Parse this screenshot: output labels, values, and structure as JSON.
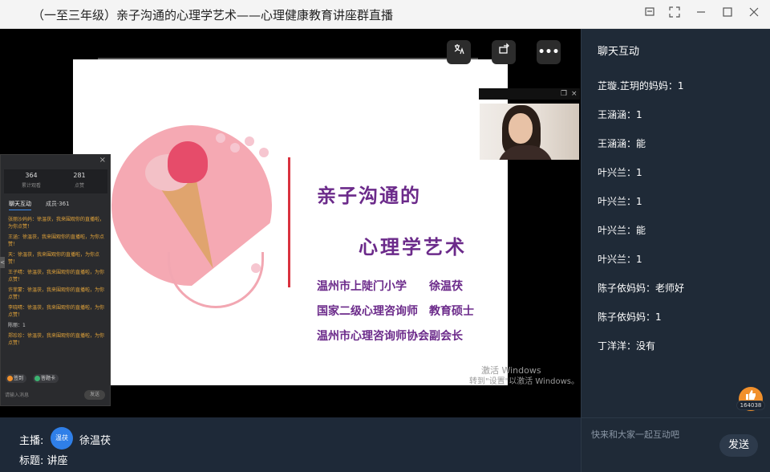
{
  "window": {
    "title": "（一至三年级）亲子沟通的心理学艺术——心理健康教育讲座群直播",
    "icons": [
      "pin-icon",
      "fullscreen-icon",
      "minimize-icon",
      "maximize-icon",
      "close-icon"
    ]
  },
  "stage": {
    "controls": [
      "translate-icon",
      "rotate-icon",
      "more-icon"
    ],
    "more_label": "•••"
  },
  "slide": {
    "title_line1": "亲子沟通的",
    "title_line2": "心理学艺术",
    "info_lines": [
      "温州市上陡门小学　　徐温茯",
      "国家二级心理咨询师　教育硕士",
      "温州市心理咨询师协会副会长"
    ],
    "watermark_line1": "激活 Windows",
    "watermark_line2": "转到\"设置\"以激活 Windows。"
  },
  "mini_panel": {
    "stat1_value": "364",
    "stat1_label": "累计观看",
    "stat2_value": "281",
    "stat2_label": "点赞",
    "tab1": "聊天互动",
    "tab2": "成员·361",
    "messages": [
      {
        "text": "张丽沙妈妈：徐温茯，我来围观你的直播啦，为你点赞！",
        "type": "msg"
      },
      {
        "text": "王涵：徐温茯，我来围观你的直播啦，为你点赞！",
        "type": "msg"
      },
      {
        "text": "天：徐温茯，我来围观你的直播啦，为你点赞！",
        "type": "msg"
      },
      {
        "text": "王子晴：徐温茯，我来围观你的直播啦，为你点赞！",
        "type": "msg"
      },
      {
        "text": "许菲蒙：徐温茯，我来围观你的直播啦，为你点赞！",
        "type": "msg"
      },
      {
        "text": "李晓晴：徐温茯，我来围观你的直播啦，为你点赞！",
        "type": "msg"
      },
      {
        "text": "陈丽：1",
        "type": "sys"
      },
      {
        "text": "郑珍珍：徐温茯，我来围观你的直播啦，为你点赞！",
        "type": "msg"
      }
    ],
    "badge1": "签到",
    "badge2": "答题卡",
    "input_placeholder": "请输入消息",
    "send_label": "发送",
    "close_label": "×",
    "handle_label": "<"
  },
  "chat": {
    "header": "聊天互动",
    "messages": [
      "芷璇.芷玥的妈妈：1",
      "王涵涵：1",
      "王涵涵：能",
      "叶兴兰：1",
      "叶兴兰：1",
      "叶兴兰：能",
      "叶兴兰：1",
      "陈子依妈妈：老师好",
      "陈子依妈妈：1",
      "丁洋洋：没有"
    ],
    "like_count": "164038",
    "like_icon": "thumbs-up-icon"
  },
  "bottom": {
    "host_label": "主播:",
    "host_avatar_text": "温茯",
    "host_name": "徐温茯",
    "title_label": "标题:",
    "title_value": "讲座"
  },
  "compose": {
    "placeholder": "快来和大家一起互动吧",
    "send_label": "发送"
  },
  "colors": {
    "slide_purple": "#6b2a8a",
    "accent_red": "#d9323f",
    "panel_bg": "#1f2a37",
    "avatar_blue": "#2f7fe8",
    "like_orange": "#f1902b"
  }
}
